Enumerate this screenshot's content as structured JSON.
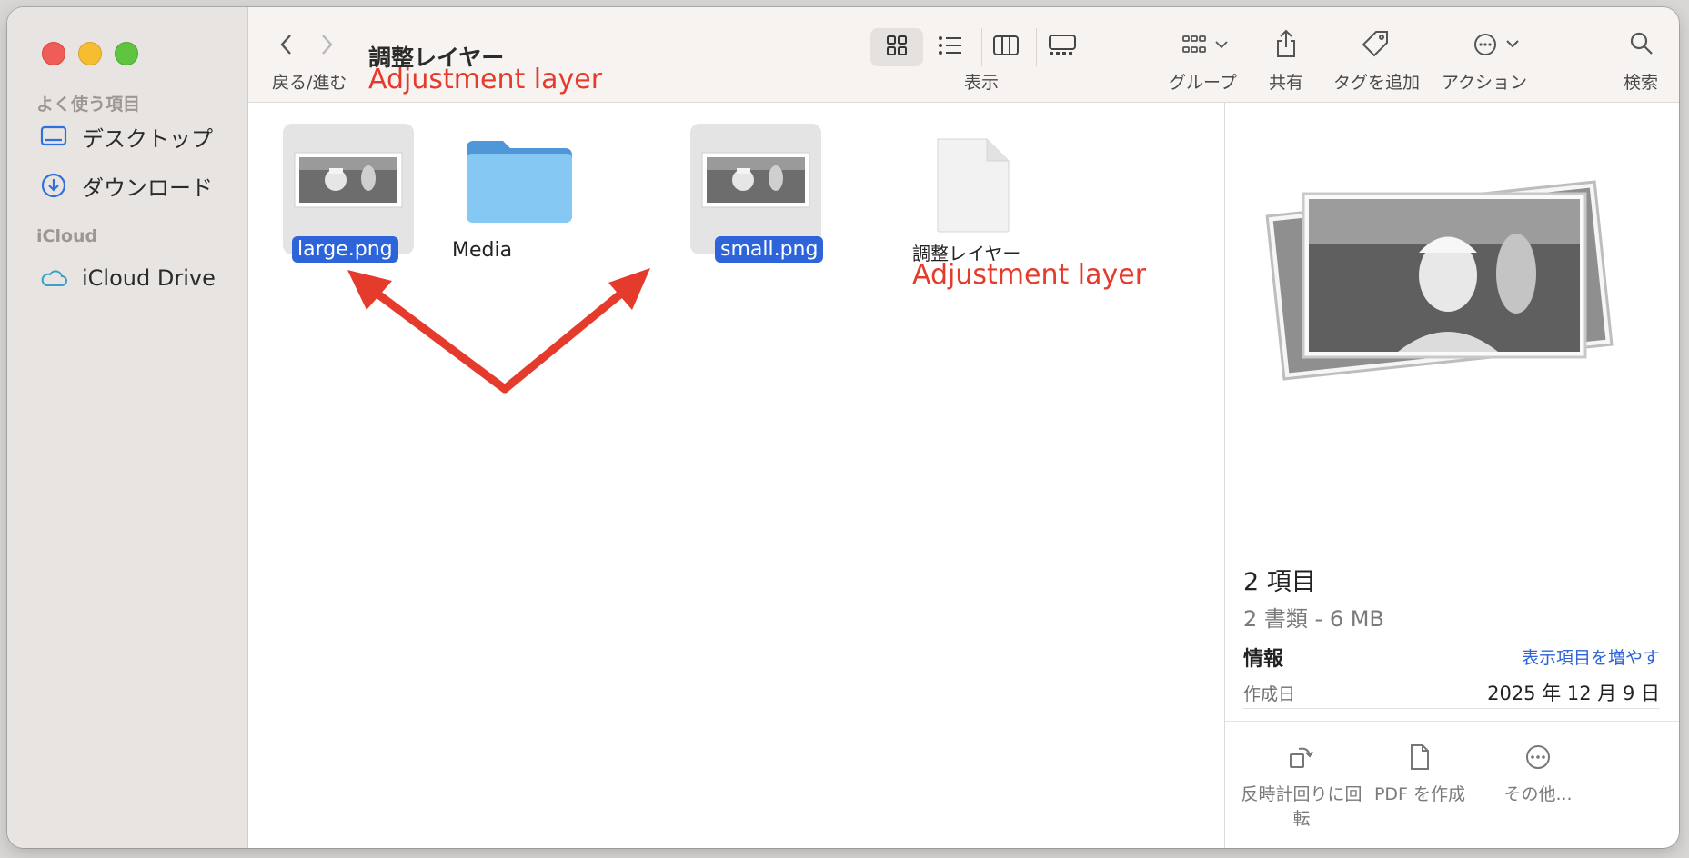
{
  "sidebar": {
    "favorites_header": "よく使う項目",
    "items": [
      {
        "label": "デスクトップ",
        "icon": "desktop-icon"
      },
      {
        "label": "ダウンロード",
        "icon": "download-icon"
      }
    ],
    "icloud_header": "iCloud",
    "icloud_items": [
      {
        "label": "iCloud Drive",
        "icon": "cloud-icon"
      }
    ]
  },
  "toolbar": {
    "nav_label": "戻る/進む",
    "title": "調整レイヤー",
    "title_annotation": "Adjustment layer",
    "view_label": "表示",
    "group_label": "グループ",
    "share_label": "共有",
    "tag_label": "タグを追加",
    "action_label": "アクション",
    "search_label": "検索"
  },
  "files": [
    {
      "name": "large.png",
      "selected": true,
      "kind": "image"
    },
    {
      "name": "Media",
      "selected": false,
      "kind": "folder"
    },
    {
      "name": "small.png",
      "selected": true,
      "kind": "image"
    },
    {
      "name": "調整レイヤー",
      "annotation": "Adjustment layer",
      "selected": false,
      "kind": "document"
    }
  ],
  "preview": {
    "title": "2 項目",
    "subtitle": "2 書類 - 6 MB",
    "info_header": "情報",
    "show_more": "表示項目を増やす",
    "created_label": "作成日",
    "created_value": "2025 年 12 月 9 日",
    "actions": [
      {
        "label": "反時計回りに回転",
        "icon": "rotate-left-icon"
      },
      {
        "label": "PDF を作成",
        "icon": "document-icon"
      },
      {
        "label": "その他...",
        "icon": "more-icon"
      }
    ]
  },
  "colors": {
    "selection": "#2e64d9",
    "annotation": "#e53b2c",
    "folder": "#6fb6ee"
  }
}
